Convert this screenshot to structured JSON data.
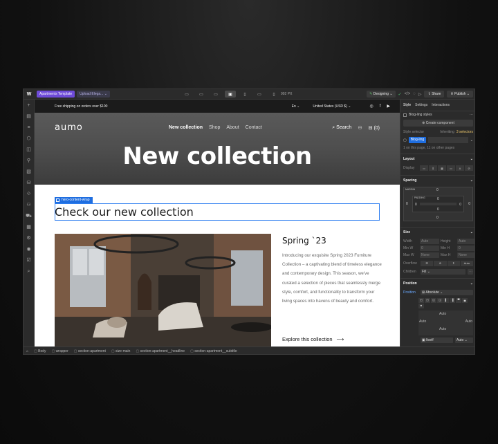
{
  "topbar": {
    "project": "Apartments Template",
    "page": "Upload Elega...",
    "width_readout": "992 PX",
    "mode": "Designing",
    "share": "Share",
    "publish": "Publish"
  },
  "site": {
    "shipping": "Free shipping on orders over $100",
    "lang": "En",
    "currency": "United States (USD $)",
    "logo": "aumo",
    "nav": [
      "New collection",
      "Shop",
      "About",
      "Contact"
    ],
    "search": "Search",
    "cart": "(0)",
    "hero_title": "New collection",
    "selected_tag": "hero-content-wrap",
    "headline": "Check our new collection",
    "spring_title": "Spring `23",
    "spring_desc": "Introducing our exquisite Spring 2023 Furniture Collection – a captivating blend of timeless elegance and contemporary design. This season, we've curated a selection of pieces that seamlessly merge style, comfort, and functionality to transform your living spaces into havens of beauty and comfort.",
    "explore": "Explore this collection"
  },
  "panel": {
    "tabs": [
      "Style",
      "Settings",
      "Interactions"
    ],
    "class_name": "Blog-ling styles",
    "create_component": "Create component",
    "style_selector": "Style selector",
    "inheriting_prefix": "Inheriting",
    "inheriting_count": "3 selectors",
    "selector_tag": "Blog-ling",
    "on_page": "1 on this page, 11 on other pages",
    "layout": "Layout",
    "display": "Display",
    "spacing": "Spacing",
    "margin_label": "MARGIN",
    "padding_label": "PADDING",
    "zero": "0",
    "size": "Size",
    "width": "Width",
    "height": "Height",
    "min_w": "Min W",
    "min_h": "Min H",
    "max_w": "Max W",
    "max_h": "Max H",
    "auto": "Auto",
    "none": "None",
    "overflow": "Overflow",
    "children": "Children",
    "fill": "Fill",
    "position": "Position",
    "position_label": "Position",
    "position_value": "Absolute",
    "itself": "Itself"
  },
  "breadcrumbs": [
    "Body",
    "wrapper",
    "section-apartment",
    "size-main",
    "section-apartment__headline",
    "section-apartment__subtitle"
  ]
}
